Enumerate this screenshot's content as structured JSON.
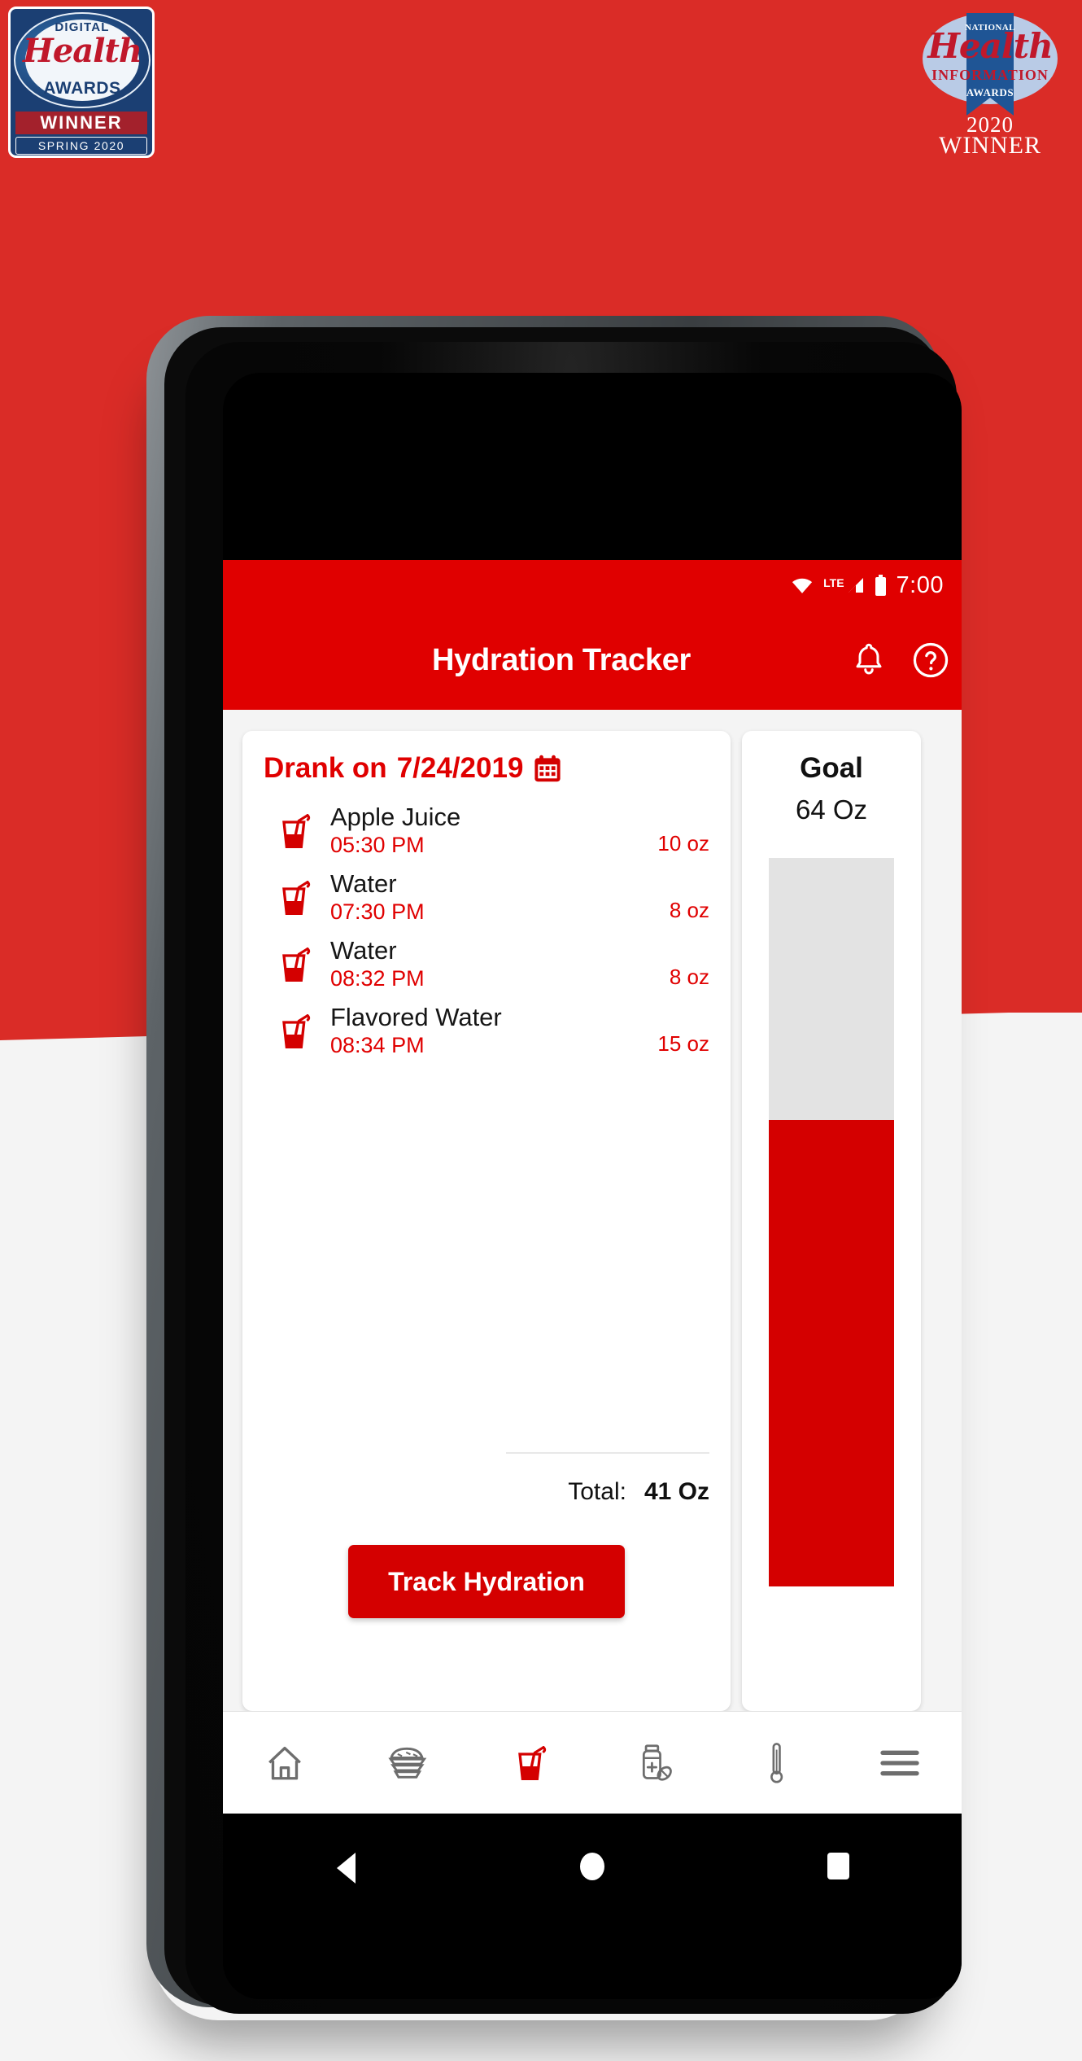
{
  "awards": {
    "digital_health": {
      "top_label": "DIGITAL",
      "script_label": "Health",
      "bottom_label": "AWARDS",
      "registered_mark": "®",
      "winner_label": "WINNER",
      "season_label": "SPRING 2020"
    },
    "national_health_information": {
      "top_label": "NATIONAL",
      "script_label": "Health",
      "mid_label": "INFORMATION",
      "sub_label": "AWARDS",
      "year_label": "2020",
      "winner_label": "WINNER"
    }
  },
  "phone": {
    "statusbar": {
      "network_label": "LTE",
      "time": "7:00",
      "wifi_icon": "wifi-icon",
      "signal_icon": "signal-bars-icon",
      "battery_icon": "battery-full-icon"
    },
    "appbar": {
      "title": "Hydration Tracker",
      "notification_icon": "bell-icon",
      "help_icon": "question-circle-icon"
    },
    "drank_card": {
      "header_prefix": "Drank on",
      "date": "7/24/2019",
      "calendar_icon": "calendar-icon",
      "entries": [
        {
          "icon": "drink-glass-icon",
          "name": "Apple Juice",
          "time": "05:30 PM",
          "amount": "10 oz"
        },
        {
          "icon": "drink-glass-icon",
          "name": "Water",
          "time": "07:30 PM",
          "amount": "8 oz"
        },
        {
          "icon": "drink-glass-icon",
          "name": "Water",
          "time": "08:32 PM",
          "amount": "8 oz"
        },
        {
          "icon": "drink-glass-icon",
          "name": "Flavored Water",
          "time": "08:34 PM",
          "amount": "15 oz"
        }
      ],
      "total_label": "Total:",
      "total_value": "41 Oz",
      "track_button_label": "Track Hydration"
    },
    "goal_card": {
      "title": "Goal",
      "value": "64 Oz",
      "progress_percent": 64
    },
    "bottom_nav": [
      {
        "icon": "home-icon",
        "name": "home",
        "active": false
      },
      {
        "icon": "sandwich-icon",
        "name": "nutrition",
        "active": false
      },
      {
        "icon": "drink-glass-icon",
        "name": "hydration",
        "active": true
      },
      {
        "icon": "medication-icon",
        "name": "medication",
        "active": false
      },
      {
        "icon": "thermometer-icon",
        "name": "vitals",
        "active": false
      },
      {
        "icon": "hamburger-icon",
        "name": "menu",
        "active": false
      }
    ],
    "android_nav": {
      "back_icon": "triangle-back-icon",
      "home_icon": "circle-home-icon",
      "recents_icon": "square-recents-icon"
    }
  },
  "colors": {
    "banner_red": "#da2c27",
    "brand_red": "#e00000",
    "button_red": "#d40000",
    "goal_track": "#e3e3e3",
    "page_bg": "#f4f4f4",
    "card_bg": "#ffffff",
    "badge_navy": "#1b3f73",
    "badge_script_red": "#c0182b"
  }
}
